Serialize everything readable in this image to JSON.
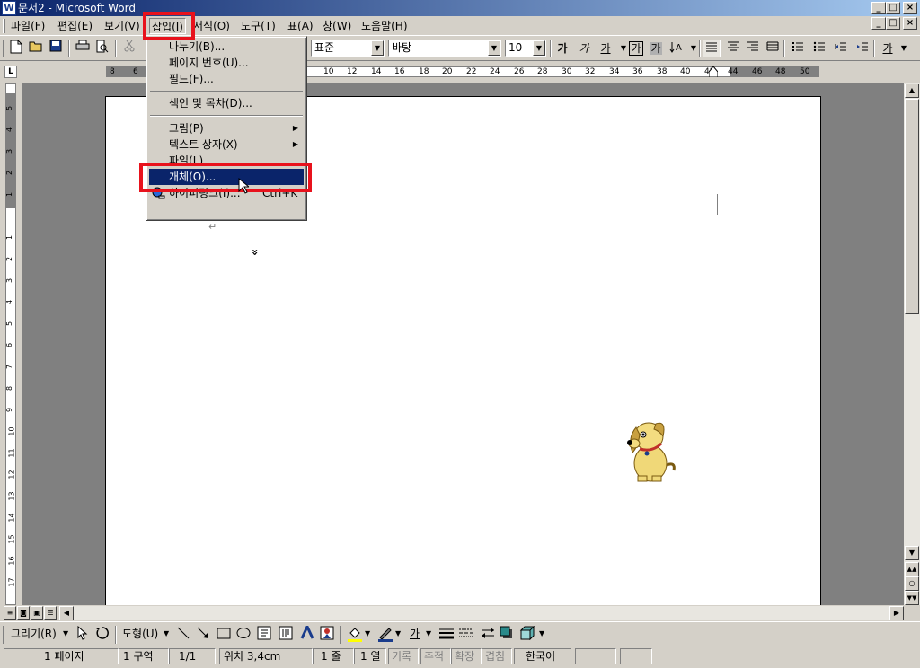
{
  "window": {
    "title": "문서2 - Microsoft Word",
    "app_icon_glyph": "W",
    "controls": {
      "minimize": "_",
      "maximize": "□",
      "close": "×"
    }
  },
  "menubar": {
    "items": [
      {
        "label": "파일(F)"
      },
      {
        "label": "편집(E)"
      },
      {
        "label": "보기(V)"
      },
      {
        "label": "삽입(I)"
      },
      {
        "label": "서식(O)"
      },
      {
        "label": "도구(T)"
      },
      {
        "label": "표(A)"
      },
      {
        "label": "창(W)"
      },
      {
        "label": "도움말(H)"
      }
    ],
    "active_item": "삽입(I)"
  },
  "toolbar": {
    "style_value": "표준",
    "font_value": "바탕",
    "size_value": "10",
    "bold": "가",
    "italic": "가",
    "underline": "가",
    "char_border": "가",
    "char_shade": "가",
    "font_color_glyph": "가"
  },
  "ruler": {
    "corner": "L",
    "h_labels": [
      "8",
      "6",
      "10",
      "12",
      "14",
      "16",
      "18",
      "20",
      "22",
      "24",
      "26",
      "28",
      "30",
      "32",
      "34",
      "36",
      "38",
      "40",
      "42",
      "44",
      "46",
      "48",
      "50"
    ],
    "v_labels": [
      "5",
      "4",
      "3",
      "2",
      "1",
      "1",
      "2",
      "3",
      "4",
      "5",
      "6",
      "7",
      "8",
      "9",
      "10",
      "11",
      "12",
      "13",
      "14",
      "15",
      "16",
      "17"
    ]
  },
  "insert_menu": {
    "items": [
      {
        "label": "나누기(B)...",
        "submenu": false
      },
      {
        "label": "페이지 번호(U)...",
        "submenu": false
      },
      {
        "label": "필드(F)...",
        "submenu": false
      },
      {
        "label": "색인 및 목차(D)...",
        "submenu": false
      },
      {
        "label": "그림(P)",
        "submenu": true
      },
      {
        "label": "텍스트 상자(X)",
        "submenu": true
      },
      {
        "label": "파일(L)...",
        "submenu": false
      },
      {
        "label": "개체(O)...",
        "submenu": false
      },
      {
        "label": "하이퍼링크(I)...",
        "shortcut": "Ctrl+K",
        "submenu": false
      }
    ],
    "selected": "개체(O)...",
    "expand_glyph": "»"
  },
  "document": {
    "paragraph_mark": "↵"
  },
  "drawing_toolbar": {
    "draw_label": "그리기(R)",
    "autoshapes_label": "도형(U)",
    "font_color_glyph": "가"
  },
  "statusbar": {
    "page": "1 페이지",
    "section": "1 구역",
    "page_of": "1/1",
    "position": "위치 3,4cm",
    "line": "1 줄",
    "column": "1 열",
    "rec": "기록",
    "trk": "추적",
    "ext": "확장",
    "ovr": "겹침",
    "language": "한국어"
  },
  "colors": {
    "highlight_box": "#e8121c",
    "menu_selection": "#0a246a",
    "title_gradient_start": "#0a246a",
    "title_gradient_end": "#a6caf0"
  }
}
